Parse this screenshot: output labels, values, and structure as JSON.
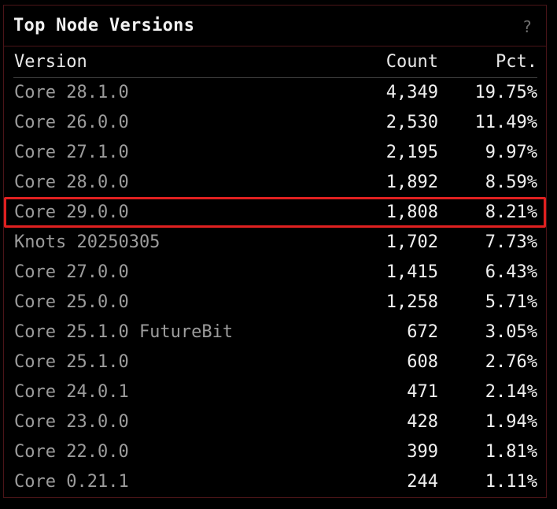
{
  "panel": {
    "title": "Top Node Versions",
    "help_glyph": "?"
  },
  "table": {
    "headers": {
      "version": "Version",
      "count": "Count",
      "pct": "Pct."
    },
    "rows": [
      {
        "version": "Core 28.1.0",
        "count": "4,349",
        "pct": "19.75%"
      },
      {
        "version": "Core 26.0.0",
        "count": "2,530",
        "pct": "11.49%"
      },
      {
        "version": "Core 27.1.0",
        "count": "2,195",
        "pct": "9.97%"
      },
      {
        "version": "Core 28.0.0",
        "count": "1,892",
        "pct": "8.59%"
      },
      {
        "version": "Core 29.0.0",
        "count": "1,808",
        "pct": "8.21%"
      },
      {
        "version": "Knots 20250305",
        "count": "1,702",
        "pct": "7.73%"
      },
      {
        "version": "Core 27.0.0",
        "count": "1,415",
        "pct": "6.43%"
      },
      {
        "version": "Core 25.0.0",
        "count": "1,258",
        "pct": "5.71%"
      },
      {
        "version": "Core 25.1.0 FutureBit",
        "count": "672",
        "pct": "3.05%"
      },
      {
        "version": "Core 25.1.0",
        "count": "608",
        "pct": "2.76%"
      },
      {
        "version": "Core 24.0.1",
        "count": "471",
        "pct": "2.14%"
      },
      {
        "version": "Core 23.0.0",
        "count": "428",
        "pct": "1.94%"
      },
      {
        "version": "Core 22.0.0",
        "count": "399",
        "pct": "1.81%"
      },
      {
        "version": "Core 0.21.1",
        "count": "244",
        "pct": "1.11%"
      }
    ],
    "highlighted_version": "Core 29.0.0"
  },
  "colors": {
    "background": "#000000",
    "border": "#4a1418",
    "highlight": "#e02020",
    "version_text": "#9c9c9c",
    "value_text": "#f0f0f0"
  }
}
